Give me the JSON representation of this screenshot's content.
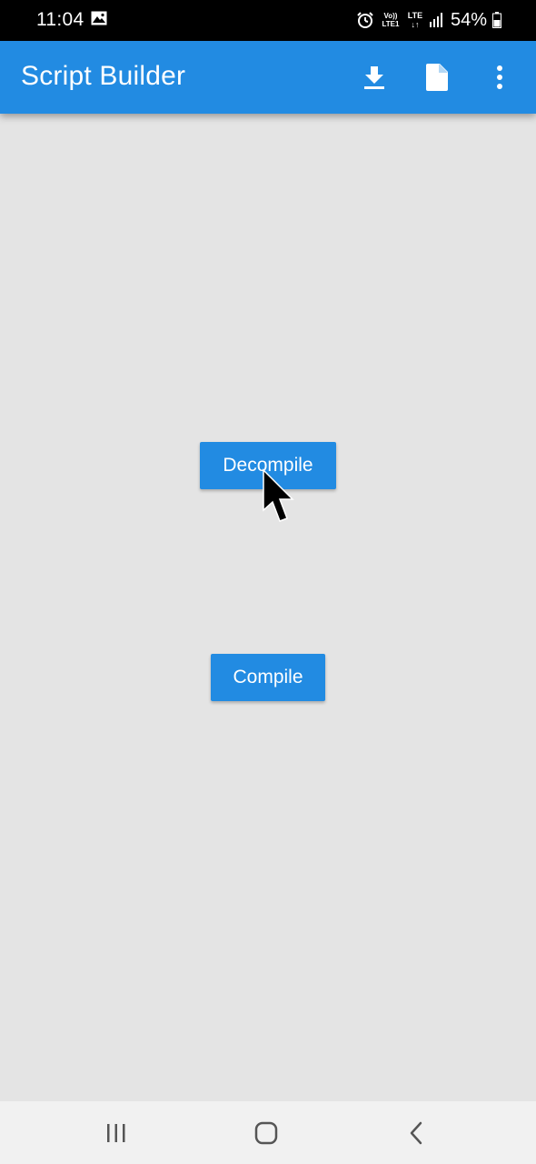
{
  "status_bar": {
    "time": "11:04",
    "volte_line1": "Vo))",
    "volte_line2": "LTE1",
    "lte_line1": "LTE",
    "lte_line2": "↓↑",
    "battery": "54%"
  },
  "app_bar": {
    "title": "Script Builder",
    "icons": [
      "download-icon",
      "file-icon",
      "more-vert-icon"
    ],
    "color": "#228be2"
  },
  "main": {
    "decompile_label": "Decompile",
    "compile_label": "Compile",
    "background": "#e4e4e4",
    "button_color": "#228be2"
  },
  "nav_bar": {
    "icons": [
      "recents-icon",
      "home-icon",
      "back-icon"
    ]
  }
}
